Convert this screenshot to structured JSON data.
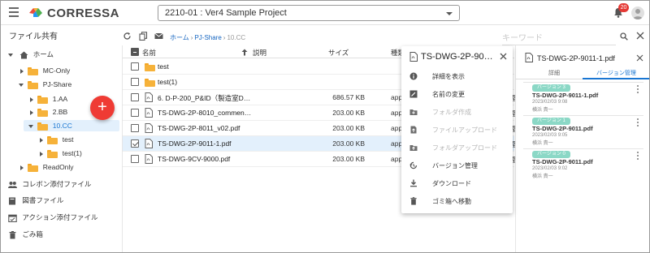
{
  "app": {
    "brand": "CORRESSA",
    "project": "2210-01 : Ver4 Sample Project",
    "notifications": "20"
  },
  "toolbar": {
    "section_title": "ファイル共有",
    "breadcrumb": [
      "ホーム",
      "PJ-Share",
      "10.CC"
    ],
    "keyword_placeholder": "キーワード"
  },
  "sidebar": {
    "tree": [
      {
        "label": "ホーム",
        "level": 0
      },
      {
        "label": "MC-Only",
        "level": 1
      },
      {
        "label": "PJ-Share",
        "level": 1
      },
      {
        "label": "1.AA",
        "level": 2
      },
      {
        "label": "2.BB",
        "level": 2
      },
      {
        "label": "10.CC",
        "level": 2,
        "selected": true
      },
      {
        "label": "test",
        "level": 3
      },
      {
        "label": "test(1)",
        "level": 3
      },
      {
        "label": "ReadOnly",
        "level": 1
      }
    ],
    "nav": [
      "コレボン添付ファイル",
      "図書ファイル",
      "アクション添付ファイル",
      "ごみ箱"
    ]
  },
  "list": {
    "columns": {
      "name": "名前",
      "desc": "説明",
      "size": "サイズ",
      "type": "種類"
    },
    "rows": [
      {
        "name": "test",
        "kind": "folder",
        "size": "",
        "type": "",
        "extra": ""
      },
      {
        "name": "test(1)",
        "kind": "folder",
        "size": "",
        "type": "",
        "extra": ""
      },
      {
        "name": "6. D-P-200_P&ID（製造室D…",
        "kind": "pdf",
        "size": "686.57 KB",
        "type": "app",
        "extra": "樫"
      },
      {
        "name": "TS-DWG-2P-8010_commen…",
        "kind": "pdf",
        "size": "203.00 KB",
        "type": "app",
        "extra": "樫"
      },
      {
        "name": "TS-DWG-2P-8011_v02.pdf",
        "kind": "pdf",
        "size": "203.00 KB",
        "type": "app",
        "extra": "樫"
      },
      {
        "name": "TS-DWG-2P-9011-1.pdf",
        "kind": "pdf",
        "size": "203.00 KB",
        "type": "app",
        "extra": "樫",
        "selected": true
      },
      {
        "name": "TS-DWG-9CV-9000.pdf",
        "kind": "pdf",
        "size": "203.00 KB",
        "type": "app",
        "extra": "樫"
      }
    ]
  },
  "context_menu": {
    "title": "TS-DWG-2P-9011-1.pdf",
    "items": [
      {
        "label": "詳細を表示",
        "icon": "info-icon",
        "disabled": false
      },
      {
        "label": "名前の変更",
        "icon": "rename-icon",
        "disabled": false
      },
      {
        "label": "フォルダ作成",
        "icon": "new-folder-icon",
        "disabled": true
      },
      {
        "label": "ファイルアップロード",
        "icon": "file-upload-icon",
        "disabled": true
      },
      {
        "label": "フォルダアップロード",
        "icon": "folder-upload-icon",
        "disabled": true
      },
      {
        "label": "バージョン管理",
        "icon": "history-icon",
        "disabled": false
      },
      {
        "label": "ダウンロード",
        "icon": "download-icon",
        "disabled": false
      },
      {
        "label": "ゴミ箱へ移動",
        "icon": "trash-icon",
        "disabled": false
      }
    ]
  },
  "detail_panel": {
    "title": "TS-DWG-2P-9011-1.pdf",
    "tabs": [
      "詳細",
      "バージョン管理"
    ],
    "versions": [
      {
        "badge": "バージョン 3",
        "name": "TS-DWG-2P-9011-1.pdf",
        "date": "2023/02/03 9:08",
        "user": "横浜 責一"
      },
      {
        "badge": "バージョン 1",
        "name": "TS-DWG-2P-9011.pdf",
        "date": "2023/02/03 9:05",
        "user": "横浜 責一"
      },
      {
        "badge": "バージョン 0",
        "name": "TS-DWG-2P-9011.pdf",
        "date": "2023/02/03 9:02",
        "user": "横浜 責一"
      }
    ]
  },
  "colors": {
    "accent": "#1976d2",
    "fab": "#ef3b34",
    "folder": "#f6b23a",
    "selection": "#e3f0fc",
    "version_badge": "#8bd8c6"
  }
}
